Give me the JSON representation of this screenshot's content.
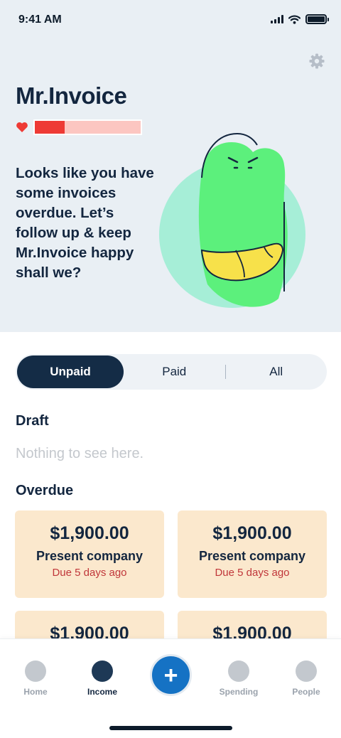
{
  "status_bar": {
    "time": "9:41 AM"
  },
  "header": {
    "title": "Mr.Invoice",
    "health_level": 0.28,
    "message": "Looks like you have some invoices overdue. Let’s follow up & keep Mr.Invoice happy shall we?"
  },
  "filter_tabs": [
    {
      "label": "Unpaid",
      "active": true
    },
    {
      "label": "Paid",
      "active": false
    },
    {
      "label": "All",
      "active": false
    }
  ],
  "draft": {
    "title": "Draft",
    "empty_text": "Nothing to see here."
  },
  "overdue": {
    "title": "Overdue",
    "invoices": [
      {
        "amount": "$1,900.00",
        "company": "Present company",
        "due": "Due 5 days ago"
      },
      {
        "amount": "$1,900.00",
        "company": "Present company",
        "due": "Due 5 days ago"
      },
      {
        "amount": "$1,900.00",
        "company": "",
        "due": ""
      },
      {
        "amount": "$1,900.00",
        "company": "",
        "due": ""
      }
    ]
  },
  "tab_bar": {
    "items": [
      {
        "label": "Home",
        "icon": "home-icon"
      },
      {
        "label": "Income",
        "icon": "income-icon",
        "active": true
      },
      {
        "label": "Spending",
        "icon": "spending-icon"
      },
      {
        "label": "People",
        "icon": "people-icon"
      }
    ],
    "add_label": "+"
  },
  "colors": {
    "hero_background": "#e9eff4",
    "primary_dark": "#142c46",
    "accent_blue": "#1572c4",
    "card_overdue": "#fbe8cd",
    "due_red": "#c0363a",
    "health_red": "#ee3a35",
    "mascot_green": "#5cf07c"
  }
}
